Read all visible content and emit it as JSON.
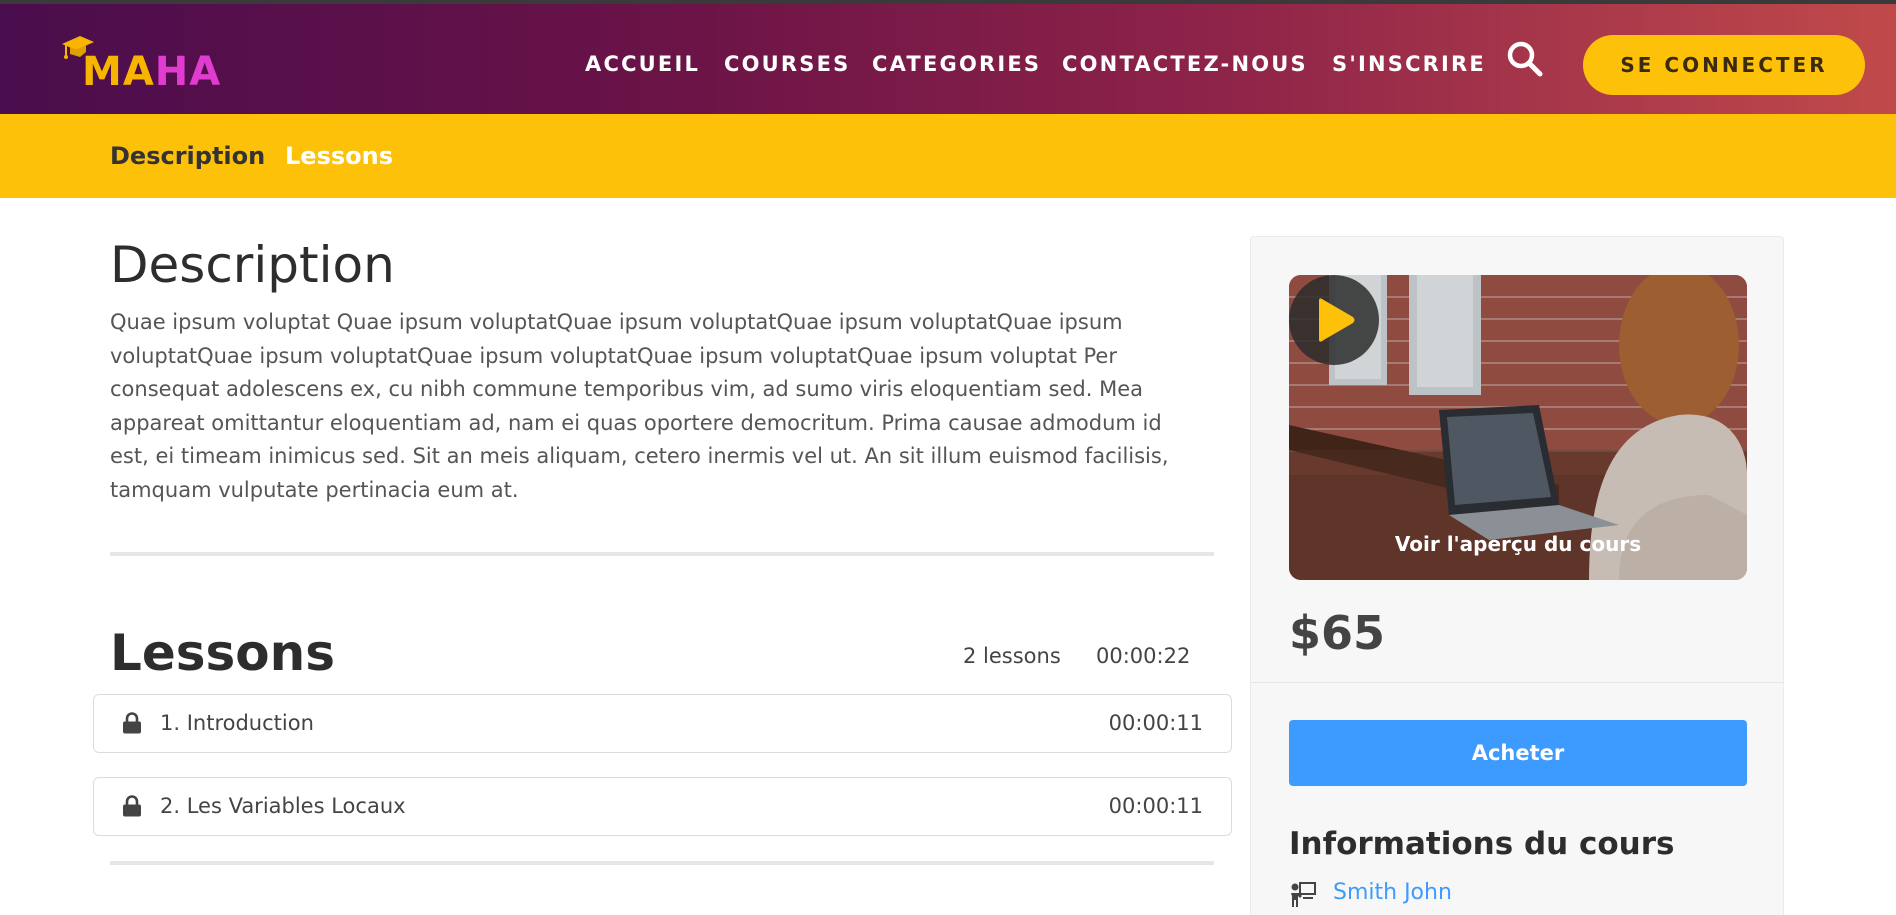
{
  "logo": {
    "letters": [
      "M",
      "A",
      "H",
      "A"
    ],
    "icon": "graduation-cap-icon"
  },
  "nav": {
    "items": [
      "ACCUEIL",
      "COURSES",
      "CATEGORIES",
      "CONTACTEZ-NOUS",
      "S'INSCRIRE"
    ],
    "search_icon": "search-icon",
    "login_label": "SE CONNECTER"
  },
  "subnav": {
    "description": "Description",
    "lessons": "Lessons"
  },
  "main": {
    "description_heading": "Description",
    "description_text": "Quae ipsum voluptat Quae ipsum voluptatQuae ipsum voluptatQuae ipsum voluptatQuae ipsum voluptatQuae ipsum voluptatQuae ipsum voluptatQuae ipsum voluptatQuae ipsum voluptat Per consequat adolescens ex, cu nibh commune temporibus vim, ad sumo viris eloquentiam sed. Mea appareat omittantur eloquentiam ad, nam ei quas oportere democritum. Prima causae admodum id est, ei timeam inimicus sed. Sit an meis aliquam, cetero inermis vel ut. An sit illum euismod facilisis, tamquam vulputate pertinacia eum at.",
    "lessons_heading": "Lessons",
    "lessons_count": "2 lessons",
    "lessons_total": "00:00:22",
    "lessons": [
      {
        "title": "1. Introduction",
        "duration": "00:00:11",
        "icon": "lock-icon"
      },
      {
        "title": "2. Les Variables Locaux",
        "duration": "00:00:11",
        "icon": "lock-icon"
      }
    ]
  },
  "sidebar": {
    "preview_label": "Voir l'aperçu du cours",
    "price": "$65",
    "buy_label": "Acheter",
    "info_title": "Informations du cours",
    "teacher_icon": "teacher-icon",
    "teacher_name": "Smith John"
  },
  "colors": {
    "header_gradient_start": "#4a0d4d",
    "header_gradient_end": "#c04a4a",
    "accent_yellow": "#fdc10a",
    "logo_magenta": "#e13cd0",
    "button_blue": "#3d9bff",
    "sidebar_bg": "#f7f7f7"
  }
}
